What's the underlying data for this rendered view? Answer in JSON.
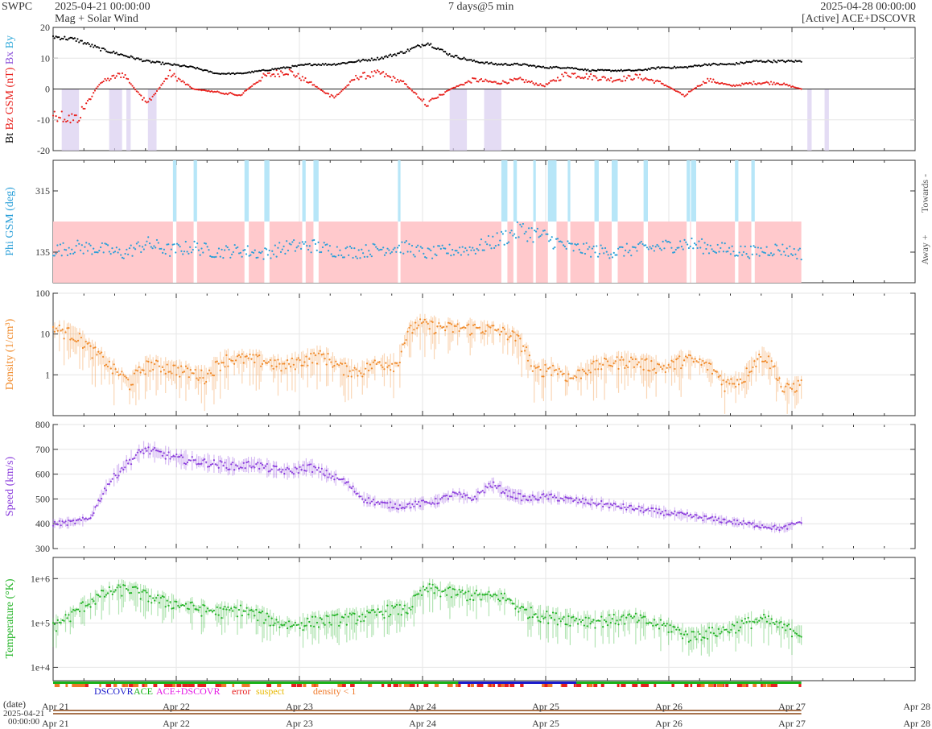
{
  "header": {
    "brand": "SWPC",
    "start": "2025-04-21 00:00:00",
    "title": "Mag + Solar Wind",
    "span": "7 days@5 min",
    "end": "2025-04-28 00:00:00",
    "source": "[Active] ACE+DSCOVR"
  },
  "colors": {
    "bt": "#000000",
    "bz": "#e8201c",
    "by": "#2ea8d9",
    "bx": "#8c52d9",
    "phi": "#2a9fd8",
    "towards_band": "#b7e6f8",
    "away_band": "#ffc9cc",
    "density": "#f08a2a",
    "speed": "#8a3cdc",
    "temperature": "#21b324",
    "dscovr": "#1b1bcc",
    "ace": "#19b319",
    "ace_dscovr": "#e51ae5",
    "error": "#e82020",
    "suspect": "#e8b800",
    "density_lt1": "#f07a2a"
  },
  "chart_data": [
    {
      "type": "line",
      "title": "",
      "ylabel_parts": [
        "Bt",
        "Bz GSM (nT)",
        "Bx",
        "By"
      ],
      "ylim": [
        -20,
        20
      ],
      "yticks": [
        "20",
        "10",
        "0",
        "-10",
        "-20"
      ],
      "x_days": [
        "2025-04-21",
        "2025-04-28"
      ],
      "series": [
        {
          "name": "Bt",
          "values": [
            17,
            16,
            13,
            11,
            9,
            8,
            7,
            5,
            5,
            6,
            7,
            8,
            8,
            9,
            10,
            12,
            15,
            11,
            9,
            8,
            8,
            7,
            7,
            6,
            6,
            6,
            7,
            7,
            8,
            8,
            9,
            9,
            9
          ]
        },
        {
          "name": "Bz GSM",
          "values": [
            -8,
            -10,
            2,
            5,
            -5,
            5,
            0,
            -1,
            -2,
            4,
            6,
            2,
            -3,
            4,
            5,
            2,
            -5,
            0,
            3,
            2,
            3,
            1,
            5,
            4,
            3,
            4,
            2,
            -2,
            3,
            1,
            2,
            2,
            0
          ]
        }
      ]
    },
    {
      "type": "scatter",
      "ylabel": "Phi GSM (deg)",
      "ylim": [
        45,
        405
      ],
      "yticks": [
        "315",
        "135"
      ],
      "right_labels": [
        "Towards -",
        "Away +"
      ],
      "series": [
        {
          "name": "Phi GSM",
          "values": [
            140,
            150,
            145,
            130,
            160,
            140,
            150,
            135,
            140,
            130,
            150,
            155,
            140,
            135,
            145,
            150,
            130,
            140,
            145,
            170,
            200,
            180,
            150,
            140,
            135,
            145,
            150,
            160,
            150,
            140,
            135,
            145,
            130
          ]
        }
      ]
    },
    {
      "type": "line",
      "ylabel": "Density (1/cm³)",
      "yscale": "log",
      "ylim": [
        0.1,
        100
      ],
      "yticks": [
        "100",
        "10",
        "1"
      ],
      "series": [
        {
          "name": "Density",
          "values": [
            14,
            10,
            4,
            1.5,
            0.6,
            1.8,
            1.5,
            1.2,
            0.9,
            2.4,
            2.5,
            2.2,
            1.6,
            2.3,
            3,
            1.5,
            1.2,
            2,
            1.8,
            18,
            15,
            14,
            14,
            13,
            9,
            1.2,
            1.5,
            0.8,
            1.5,
            2,
            2.2,
            1.8,
            1.5,
            2.5,
            1.8,
            0.6,
            0.8,
            3,
            0.4,
            0.6
          ]
        }
      ]
    },
    {
      "type": "line",
      "ylabel": "Speed (km/s)",
      "ylim": [
        300,
        800
      ],
      "yticks": [
        "800",
        "700",
        "600",
        "500",
        "400",
        "300"
      ],
      "series": [
        {
          "name": "Speed",
          "values": [
            400,
            405,
            420,
            560,
            640,
            700,
            680,
            660,
            650,
            640,
            630,
            640,
            620,
            610,
            630,
            600,
            570,
            500,
            480,
            470,
            480,
            490,
            520,
            500,
            560,
            520,
            500,
            510,
            500,
            490,
            480,
            470,
            460,
            450,
            440,
            430,
            420,
            410,
            400,
            390,
            380,
            410
          ]
        }
      ]
    },
    {
      "type": "line",
      "ylabel": "Temperature (°K)",
      "yscale": "log",
      "ylim": [
        5000,
        3000000
      ],
      "yticks": [
        "1e+6",
        "1e+5",
        "1e+4"
      ],
      "series": [
        {
          "name": "Temperature",
          "values": [
            80000,
            150000,
            300000,
            500000,
            600000,
            400000,
            300000,
            250000,
            200000,
            180000,
            200000,
            150000,
            100000,
            90000,
            110000,
            120000,
            130000,
            150000,
            200000,
            200000,
            600000,
            500000,
            450000,
            400000,
            400000,
            200000,
            150000,
            130000,
            120000,
            110000,
            120000,
            130000,
            100000,
            80000,
            50000,
            60000,
            70000,
            100000,
            120000,
            80000,
            60000
          ]
        }
      ]
    }
  ],
  "legend": {
    "dscovr": "DSCOVR",
    "ace": "ACE",
    "ace_dscovr": "ACE+DSCOVR",
    "error": "error",
    "suspect": "suspect",
    "density_lt1": "density < 1"
  },
  "xaxis": {
    "date_label": "(date)",
    "left_date": "2025-04-21",
    "left_time": "00:00:00",
    "ticks": [
      "Apr 21",
      "Apr 22",
      "Apr 23",
      "Apr 24",
      "Apr 25",
      "Apr 26",
      "Apr 27",
      "Apr 28"
    ]
  }
}
